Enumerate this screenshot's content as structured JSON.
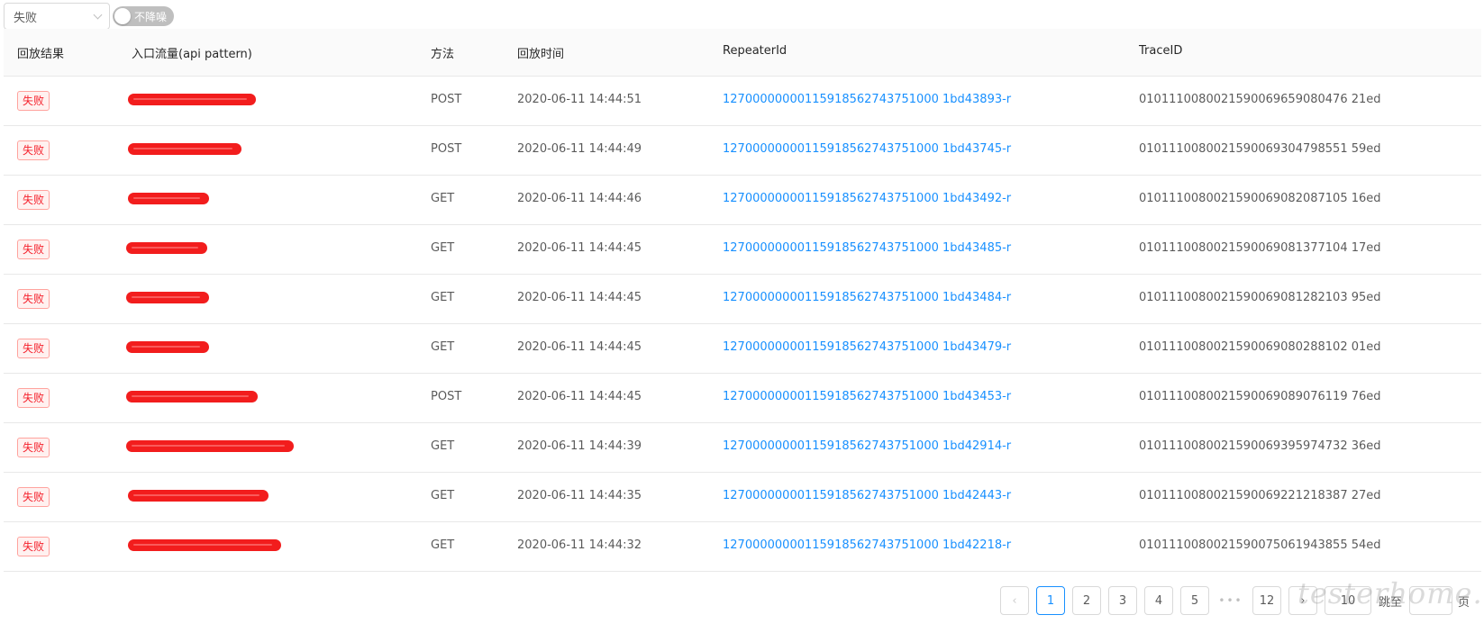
{
  "filter": {
    "status_value": "失败",
    "switch_label": "不降噪"
  },
  "table": {
    "columns": [
      "回放结果",
      "入口流量(api pattern)",
      "方法",
      "回放时间",
      "RepeaterId",
      "TraceID"
    ],
    "rows": [
      {
        "result": "失败",
        "method": "POST",
        "time": "2020-06-11 14:44:51",
        "repeater_id": "12700000000115918562743751000 1bd43893-r",
        "trace_id": "0101110080021590069659080476 21ed"
      },
      {
        "result": "失败",
        "method": "POST",
        "time": "2020-06-11 14:44:49",
        "repeater_id": "12700000000115918562743751000 1bd43745-r",
        "trace_id": "0101110080021590069304798551 59ed"
      },
      {
        "result": "失败",
        "method": "GET",
        "time": "2020-06-11 14:44:46",
        "repeater_id": "12700000000115918562743751000 1bd43492-r",
        "trace_id": "0101110080021590069082087105 16ed"
      },
      {
        "result": "失败",
        "method": "GET",
        "time": "2020-06-11 14:44:45",
        "repeater_id": "12700000000115918562743751000 1bd43485-r",
        "trace_id": "0101110080021590069081377104 17ed"
      },
      {
        "result": "失败",
        "method": "GET",
        "time": "2020-06-11 14:44:45",
        "repeater_id": "12700000000115918562743751000 1bd43484-r",
        "trace_id": "0101110080021590069081282103 95ed"
      },
      {
        "result": "失败",
        "method": "GET",
        "time": "2020-06-11 14:44:45",
        "repeater_id": "12700000000115918562743751000 1bd43479-r",
        "trace_id": "0101110080021590069080288102 01ed"
      },
      {
        "result": "失败",
        "method": "POST",
        "time": "2020-06-11 14:44:45",
        "repeater_id": "12700000000115918562743751000 1bd43453-r",
        "trace_id": "0101110080021590069089076119 76ed"
      },
      {
        "result": "失败",
        "method": "GET",
        "time": "2020-06-11 14:44:39",
        "repeater_id": "12700000000115918562743751000 1bd42914-r",
        "trace_id": "0101110080021590069395974732 36ed"
      },
      {
        "result": "失败",
        "method": "GET",
        "time": "2020-06-11 14:44:35",
        "repeater_id": "12700000000115918562743751000 1bd42443-r",
        "trace_id": "0101110080021590069221218387 27ed"
      },
      {
        "result": "失败",
        "method": "GET",
        "time": "2020-06-11 14:44:32",
        "repeater_id": "12700000000115918562743751000 1bd42218-r",
        "trace_id": "0101110080021590075061943855 54ed"
      }
    ]
  },
  "pagination": {
    "prev_icon": "chevron-left-icon",
    "next_icon": "chevron-right-icon",
    "pages": [
      "1",
      "2",
      "3",
      "4",
      "5"
    ],
    "current": "1",
    "ellipsis": "•••",
    "last": "12",
    "page_size": "10",
    "jump_label": "跳至",
    "page_suffix": "页"
  },
  "watermark": "testerhome.com",
  "colors": {
    "link": "#1890ff",
    "fail_tag_text": "#f5222d",
    "fail_tag_border": "#ffa39e",
    "fail_tag_bg": "#fff1f0",
    "redaction": "#f21d1d"
  }
}
